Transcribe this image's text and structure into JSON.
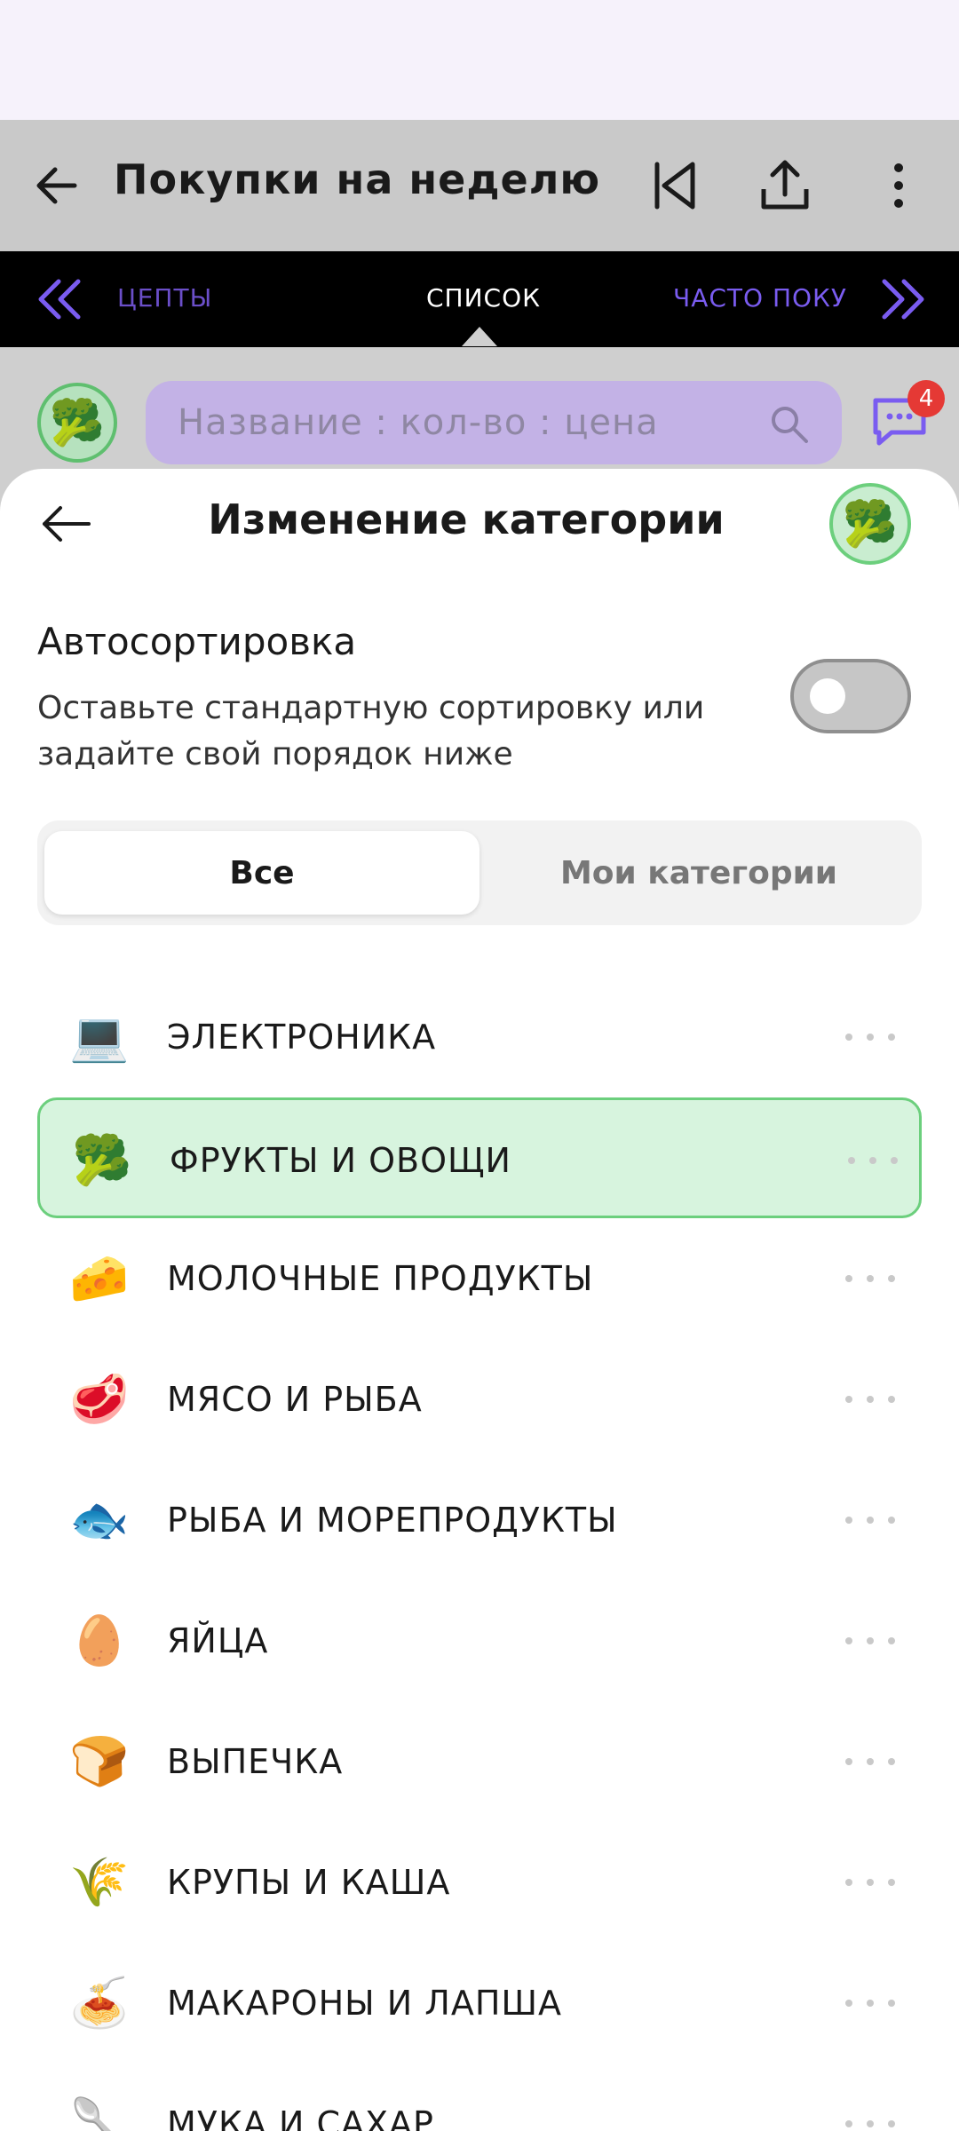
{
  "header": {
    "title": "Покупки на неделю"
  },
  "tabs": {
    "prev": "ЦЕПТЫ",
    "current": "СПИСОК",
    "next": "ЧАСТО ПОКУ"
  },
  "input": {
    "placeholder": "Название : кол-во : цена",
    "chat_badge": "4"
  },
  "sheet": {
    "title": "Изменение категории",
    "autosort_title": "Автосортировка",
    "autosort_desc": "Оставьте стандартную сортировку или задайте свой порядок ниже",
    "autosort_enabled": false,
    "segments": {
      "all": "Все",
      "mine": "Мои категории"
    },
    "categories": [
      {
        "label": "ЭЛЕКТРОНИКА",
        "icon": "laptop-icon",
        "emoji": "💻",
        "selected": false
      },
      {
        "label": "ФРУКТЫ И ОВОЩИ",
        "icon": "broccoli-icon",
        "emoji": "🥦",
        "selected": true
      },
      {
        "label": "МОЛОЧНЫЕ ПРОДУКТЫ",
        "icon": "cheese-icon",
        "emoji": "🧀",
        "selected": false
      },
      {
        "label": "МЯСО И РЫБА",
        "icon": "meat-icon",
        "emoji": "🥩",
        "selected": false
      },
      {
        "label": "РЫБА И МОРЕПРОДУКТЫ",
        "icon": "fish-icon",
        "emoji": "🐟",
        "selected": false
      },
      {
        "label": "ЯЙЦА",
        "icon": "egg-icon",
        "emoji": "🥚",
        "selected": false
      },
      {
        "label": "ВЫПЕЧКА",
        "icon": "bread-icon",
        "emoji": "🍞",
        "selected": false
      },
      {
        "label": "КРУПЫ И КАША",
        "icon": "rice-icon",
        "emoji": "🌾",
        "selected": false
      },
      {
        "label": "МАКАРОНЫ И ЛАПША",
        "icon": "pasta-icon",
        "emoji": "🍝",
        "selected": false
      },
      {
        "label": "МУКА И САХАР",
        "icon": "spoon-icon",
        "emoji": "🥄",
        "selected": false
      }
    ]
  },
  "colors": {
    "accent": "#7a5cf0",
    "selected_bg": "#d7f4de",
    "selected_border": "#6ccf7d"
  }
}
